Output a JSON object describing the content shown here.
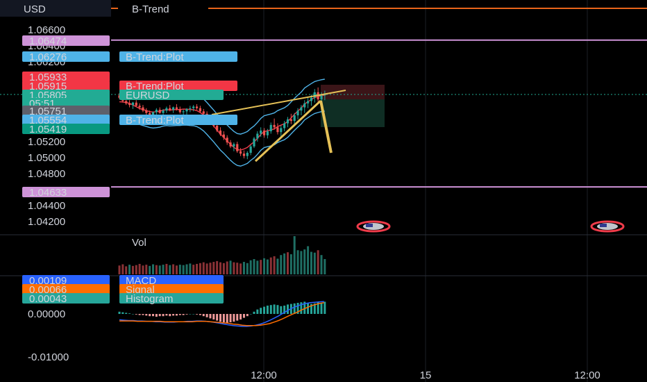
{
  "header": {
    "currency": "USD",
    "indicator": "B-Trend"
  },
  "chart_data": {
    "type": "candlestick",
    "symbol": "EURUSD",
    "price_axis": {
      "ticks": [
        "1.06600",
        "1.06400",
        "1.06200",
        "1.05200",
        "1.05000",
        "1.04800",
        "1.04400",
        "1.04200"
      ],
      "ylim": [
        1.0405,
        1.0675
      ]
    },
    "price_labels": [
      {
        "value": "1.06474",
        "text": "",
        "color": "#ce93d8"
      },
      {
        "value": "1.06276",
        "text": "B-Trend:Plot",
        "color": "#4fb3e8"
      },
      {
        "value": "1.05933",
        "text": "",
        "color": "#f23645"
      },
      {
        "value": "1.05915",
        "text": "B-Trend:Plot",
        "color": "#f23645"
      },
      {
        "value": "1.05805",
        "text": "EURUSD",
        "color": "#22ab94"
      },
      {
        "value": "05:51",
        "text": "",
        "color": "#22ab94"
      },
      {
        "value": "1.05751",
        "text": "",
        "color": "#5d606b"
      },
      {
        "value": "1.05554",
        "text": "B-Trend:Plot",
        "color": "#4fb3e8"
      },
      {
        "value": "1.05419",
        "text": "",
        "color": "#089981"
      },
      {
        "value": "1.04633",
        "text": "",
        "color": "#ce93d8"
      }
    ],
    "horizontal_levels": [
      1.06474,
      1.04633
    ],
    "current_price": 1.05805,
    "candles": [
      [
        1.0578,
        1.0581,
        1.0573,
        1.0575
      ],
      [
        1.0575,
        1.0578,
        1.0569,
        1.0571
      ],
      [
        1.0571,
        1.0574,
        1.0566,
        1.0568
      ],
      [
        1.0568,
        1.0572,
        1.0563,
        1.0566
      ],
      [
        1.0566,
        1.057,
        1.0561,
        1.0569
      ],
      [
        1.0569,
        1.0572,
        1.0564,
        1.0565
      ],
      [
        1.0565,
        1.0568,
        1.056,
        1.0563
      ],
      [
        1.0563,
        1.0566,
        1.0557,
        1.0559
      ],
      [
        1.0559,
        1.0562,
        1.0553,
        1.0556
      ],
      [
        1.0556,
        1.0559,
        1.055,
        1.0553
      ],
      [
        1.0553,
        1.0558,
        1.0549,
        1.0557
      ],
      [
        1.0557,
        1.0562,
        1.0554,
        1.056
      ],
      [
        1.056,
        1.0563,
        1.0555,
        1.0556
      ],
      [
        1.0556,
        1.0561,
        1.0553,
        1.0559
      ],
      [
        1.0559,
        1.0564,
        1.0556,
        1.0562
      ],
      [
        1.0562,
        1.0566,
        1.0558,
        1.056
      ],
      [
        1.056,
        1.0564,
        1.0556,
        1.0563
      ],
      [
        1.0563,
        1.0567,
        1.0559,
        1.0561
      ],
      [
        1.0561,
        1.0564,
        1.0555,
        1.0557
      ],
      [
        1.0557,
        1.056,
        1.0552,
        1.0558
      ],
      [
        1.0558,
        1.0562,
        1.0554,
        1.0561
      ],
      [
        1.0561,
        1.0565,
        1.0557,
        1.0562
      ],
      [
        1.0562,
        1.0566,
        1.0558,
        1.0564
      ],
      [
        1.0564,
        1.0567,
        1.056,
        1.0562
      ],
      [
        1.0562,
        1.0565,
        1.0556,
        1.0558
      ],
      [
        1.0558,
        1.0561,
        1.0552,
        1.0555
      ],
      [
        1.0555,
        1.0558,
        1.0548,
        1.055
      ],
      [
        1.055,
        1.0553,
        1.0543,
        1.0545
      ],
      [
        1.0545,
        1.0548,
        1.0538,
        1.054
      ],
      [
        1.054,
        1.0543,
        1.0532,
        1.0534
      ],
      [
        1.0534,
        1.0538,
        1.0527,
        1.0529
      ],
      [
        1.0529,
        1.0533,
        1.0522,
        1.0525
      ],
      [
        1.0525,
        1.0528,
        1.0516,
        1.0519
      ],
      [
        1.0519,
        1.0522,
        1.0512,
        1.0514
      ],
      [
        1.0514,
        1.0519,
        1.0508,
        1.0517
      ],
      [
        1.0517,
        1.052,
        1.0506,
        1.0508
      ],
      [
        1.0508,
        1.0512,
        1.0502,
        1.0505
      ],
      [
        1.0505,
        1.0509,
        1.0499,
        1.0502
      ],
      [
        1.0502,
        1.0508,
        1.0498,
        1.0506
      ],
      [
        1.0506,
        1.0516,
        1.0503,
        1.0514
      ],
      [
        1.0514,
        1.0526,
        1.0512,
        1.0524
      ],
      [
        1.0524,
        1.0533,
        1.052,
        1.053
      ],
      [
        1.053,
        1.0538,
        1.0526,
        1.0534
      ],
      [
        1.0534,
        1.0537,
        1.0525,
        1.0528
      ],
      [
        1.0528,
        1.0536,
        1.0524,
        1.0533
      ],
      [
        1.0533,
        1.0544,
        1.053,
        1.0541
      ],
      [
        1.0541,
        1.0549,
        1.0535,
        1.0538
      ],
      [
        1.0538,
        1.0543,
        1.0529,
        1.0532
      ],
      [
        1.0532,
        1.054,
        1.0526,
        1.0537
      ],
      [
        1.0537,
        1.0546,
        1.0533,
        1.0543
      ],
      [
        1.0543,
        1.0551,
        1.0538,
        1.0548
      ],
      [
        1.0548,
        1.0555,
        1.0542,
        1.0546
      ],
      [
        1.0546,
        1.0556,
        1.0541,
        1.0553
      ],
      [
        1.0553,
        1.0562,
        1.0548,
        1.0559
      ],
      [
        1.0559,
        1.0566,
        1.0553,
        1.0563
      ],
      [
        1.0563,
        1.0572,
        1.0556,
        1.0568
      ],
      [
        1.0568,
        1.0576,
        1.0562,
        1.0571
      ],
      [
        1.0571,
        1.0579,
        1.0565,
        1.0575
      ],
      [
        1.0575,
        1.0586,
        1.0569,
        1.0582
      ],
      [
        1.0582,
        1.0588,
        1.057,
        1.0573
      ],
      [
        1.0573,
        1.0582,
        1.0567,
        1.0578
      ],
      [
        1.0578,
        1.0584,
        1.0572,
        1.05805
      ]
    ],
    "volume": {
      "label": "Vol",
      "values": [
        22,
        25,
        20,
        24,
        21,
        23,
        26,
        22,
        24,
        21,
        25,
        23,
        22,
        24,
        26,
        23,
        25,
        22,
        24,
        23,
        25,
        27,
        24,
        26,
        28,
        30,
        27,
        29,
        31,
        33,
        30,
        28,
        32,
        34,
        30,
        29,
        27,
        31,
        28,
        35,
        38,
        34,
        36,
        40,
        37,
        42,
        45,
        39,
        48,
        52,
        55,
        50,
        95,
        60,
        58,
        62,
        70,
        56,
        54,
        60,
        48,
        38
      ],
      "colors": [
        "d",
        "d",
        "d",
        "u",
        "d",
        "d",
        "d",
        "d",
        "d",
        "u",
        "u",
        "d",
        "u",
        "u",
        "d",
        "u",
        "d",
        "d",
        "u",
        "u",
        "u",
        "u",
        "d",
        "d",
        "d",
        "d",
        "d",
        "d",
        "d",
        "d",
        "d",
        "d",
        "d",
        "u",
        "d",
        "d",
        "d",
        "u",
        "u",
        "u",
        "u",
        "u",
        "d",
        "u",
        "u",
        "d",
        "d",
        "u",
        "u",
        "u",
        "d",
        "u",
        "u",
        "u",
        "u",
        "u",
        "u",
        "u",
        "u",
        "d",
        "u",
        "u"
      ]
    },
    "macd": {
      "labels": [
        {
          "value": "0.00109",
          "text": "MACD",
          "color": "#2962ff"
        },
        {
          "value": "0.00066",
          "text": "Signal",
          "color": "#ff6d00"
        },
        {
          "value": "0.00043",
          "text": "Histogram",
          "color": "#26a69a"
        }
      ],
      "axis_ticks": [
        "0.00000",
        "-0.01000"
      ],
      "histogram": [
        0.0004,
        0.0003,
        0.0002,
        0.0001,
        0.0,
        -0.0001,
        -0.0002,
        -0.0002,
        -0.0003,
        -0.0004,
        -0.0004,
        -0.0005,
        -0.0004,
        -0.0004,
        -0.0003,
        -0.0004,
        -0.0003,
        -0.0003,
        -0.0002,
        -0.0002,
        -0.0001,
        0.0,
        0.0,
        -0.0001,
        -0.0002,
        -0.0004,
        -0.0006,
        -0.0008,
        -0.001,
        -0.0012,
        -0.0014,
        -0.0015,
        -0.0016,
        -0.0015,
        -0.0014,
        -0.0012,
        -0.001,
        -0.0007,
        -0.0004,
        0.0,
        0.0004,
        0.0008,
        0.0011,
        0.0013,
        0.0015,
        0.0016,
        0.0017,
        0.0016,
        0.0014,
        0.0015,
        0.0017,
        0.0018,
        0.0019,
        0.002,
        0.0021,
        0.0022,
        0.002,
        0.0018,
        0.0019,
        0.0021,
        0.002,
        0.0022
      ],
      "macd_line": [
        -0.0015,
        -0.0016,
        -0.0017,
        -0.0017,
        -0.0018,
        -0.0018,
        -0.0019,
        -0.0019,
        -0.002,
        -0.002,
        -0.0021,
        -0.0021,
        -0.0021,
        -0.002,
        -0.002,
        -0.0019,
        -0.0019,
        -0.0018,
        -0.0018,
        -0.0019,
        -0.002,
        -0.0022,
        -0.0024,
        -0.0026,
        -0.0028,
        -0.003,
        -0.0031,
        -0.0032,
        -0.0032,
        -0.0031,
        -0.0029,
        -0.0026,
        -0.0022,
        -0.0017,
        -0.0011,
        -0.0005,
        0.0002,
        0.0009,
        0.0015,
        0.002,
        0.0024,
        0.0027,
        0.0029,
        0.003,
        0.0031,
        0.0032
      ],
      "signal_line": [
        -0.0018,
        -0.0018,
        -0.0018,
        -0.0018,
        -0.0019,
        -0.0019,
        -0.0019,
        -0.0019,
        -0.0019,
        -0.0019,
        -0.002,
        -0.002,
        -0.002,
        -0.002,
        -0.002,
        -0.002,
        -0.002,
        -0.0019,
        -0.0019,
        -0.0019,
        -0.002,
        -0.0021,
        -0.0022,
        -0.0023,
        -0.0024,
        -0.0026,
        -0.0027,
        -0.0029,
        -0.003,
        -0.003,
        -0.003,
        -0.0029,
        -0.0027,
        -0.0025,
        -0.0021,
        -0.0017,
        -0.0012,
        -0.0006,
        -0.0001,
        0.0004,
        0.001,
        0.0015,
        0.002,
        0.0024,
        0.0027,
        0.0029
      ]
    },
    "time_axis": {
      "ticks": [
        "12:00",
        "15",
        "12:00"
      ]
    },
    "colors": {
      "up": "#26a69a",
      "down": "#ef5350",
      "band": "#4fb3e8",
      "trendline": "#e5c157",
      "level": "#ce93d8",
      "indicator_line": "#e8651a"
    }
  }
}
